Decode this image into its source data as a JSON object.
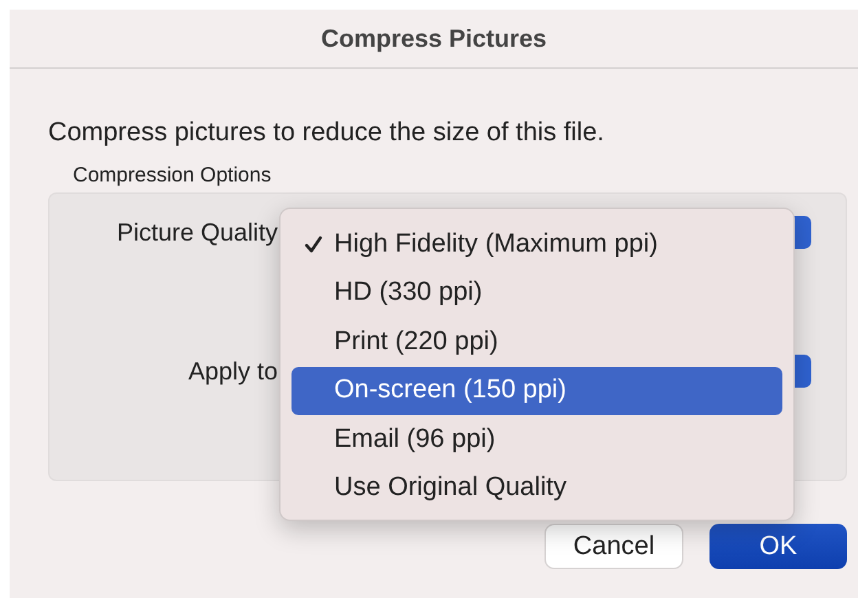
{
  "window": {
    "title": "Compress Pictures"
  },
  "description": "Compress pictures to reduce the size of this file.",
  "group": {
    "title": "Compression Options",
    "fields": [
      {
        "label": "Picture Quality"
      },
      {
        "label": "Apply to"
      }
    ]
  },
  "menu": {
    "items": [
      {
        "label": "High Fidelity (Maximum ppi)",
        "selected": true,
        "highlighted": false
      },
      {
        "label": "HD (330 ppi)",
        "selected": false,
        "highlighted": false
      },
      {
        "label": "Print (220 ppi)",
        "selected": false,
        "highlighted": false
      },
      {
        "label": "On-screen (150 ppi)",
        "selected": false,
        "highlighted": true
      },
      {
        "label": "Email (96 ppi)",
        "selected": false,
        "highlighted": false
      },
      {
        "label": "Use Original Quality",
        "selected": false,
        "highlighted": false
      }
    ]
  },
  "buttons": [
    {
      "label": "Cancel",
      "kind": "secondary"
    },
    {
      "label": "OK",
      "kind": "default"
    }
  ]
}
